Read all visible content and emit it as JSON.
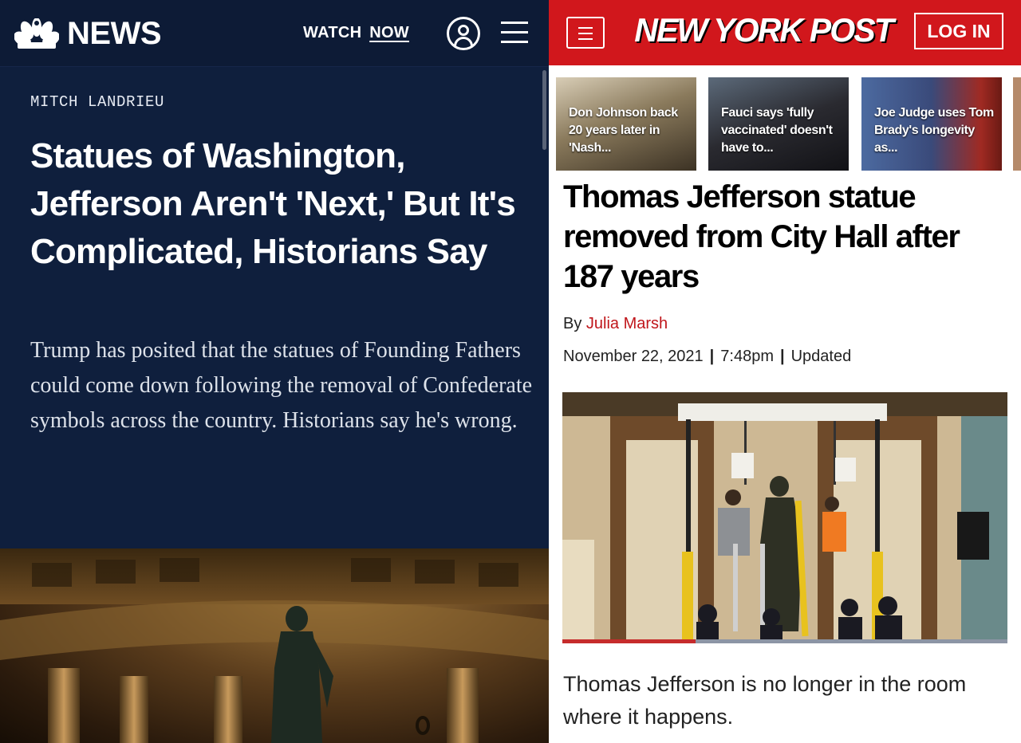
{
  "nbc": {
    "logo_text": "NEWS",
    "logo_icon": "peacock-icon",
    "watch_label": "WATCH",
    "watch_now_label": "NOW",
    "user_icon": "user-icon",
    "menu_icon": "menu-icon",
    "kicker": "MITCH LANDRIEU",
    "headline": "Statues of Washington, Jefferson Aren't 'Next,' But It's Complicated, Historians Say",
    "dek": "Trump has posited that the statues of Founding Fathers could come down following the removal of Confederate symbols across the country. Historians say he's wrong.",
    "colors": {
      "background": "#0f1f3d",
      "header": "#0d1b36",
      "text": "#ffffff"
    }
  },
  "nyp": {
    "menu_icon": "menu-icon",
    "logo_text": "NEW YORK POST",
    "login_label": "LOG IN",
    "thumbnails": [
      {
        "caption": "Don Johnson back 20 years later in 'Nash...",
        "color": "#8a7a5c"
      },
      {
        "caption": "Fauci says 'fully vaccinated' doesn't have to...",
        "color": "#2a2a30"
      },
      {
        "caption": "Joe Judge uses Tom Brady's longevity as...",
        "color": "#3a4a7a"
      }
    ],
    "headline": "Thomas Jefferson statue removed from City Hall after 187 years",
    "byline_prefix": "By",
    "byline_author": "Julia Marsh",
    "date": "November 22, 2021",
    "separator": "|",
    "time": "7:48pm",
    "updated_label": "Updated",
    "photo_progress": 0.3,
    "lede": "Thomas Jefferson is no longer in the room where it happens.",
    "colors": {
      "brand": "#d1171c",
      "author": "#c0161b",
      "text": "#222222"
    }
  }
}
